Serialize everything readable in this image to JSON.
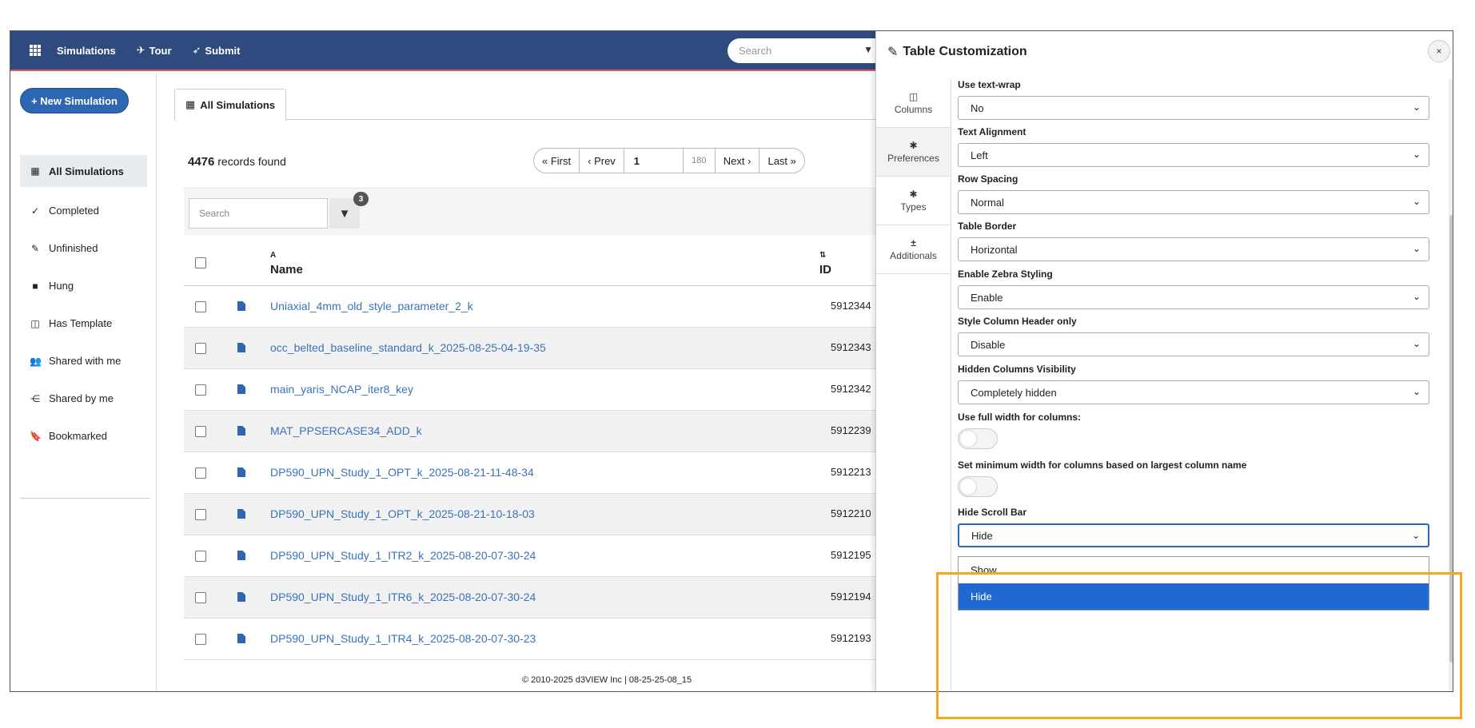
{
  "nav": {
    "items": [
      {
        "label": "Simulations",
        "icon": "grid-icon"
      },
      {
        "label": "Tour",
        "icon": "plane-icon"
      },
      {
        "label": "Submit",
        "icon": "rocket-icon"
      }
    ],
    "search_placeholder": "Search"
  },
  "sidebar": {
    "new_button": "+ New Simulation",
    "items": [
      {
        "label": "All Simulations",
        "icon": "table-icon",
        "active": true
      },
      {
        "label": "Completed",
        "icon": "check-icon"
      },
      {
        "label": "Unfinished",
        "icon": "edit-icon"
      },
      {
        "label": "Hung",
        "icon": "stop-icon"
      },
      {
        "label": "Has Template",
        "icon": "template-icon"
      },
      {
        "label": "Shared with me",
        "icon": "users-icon"
      },
      {
        "label": "Shared by me",
        "icon": "share-icon"
      },
      {
        "label": "Bookmarked",
        "icon": "bookmark-icon"
      }
    ]
  },
  "main": {
    "tab_label": "All Simulations",
    "records_count": "4476",
    "records_suffix": "records found",
    "pager": {
      "first": "« First",
      "prev": "‹ Prev",
      "page": "1",
      "total": "180",
      "next": "Next ›",
      "last": "Last »"
    },
    "search_placeholder": "Search",
    "filter_count": "3",
    "columns": {
      "name_sort": "A",
      "name": "Name",
      "id_sort": "⇅",
      "id": "ID"
    },
    "rows": [
      {
        "name": "Uniaxial_4mm_old_style_parameter_2_k",
        "id": "5912344"
      },
      {
        "name": "occ_belted_baseline_standard_k_2025-08-25-04-19-35",
        "id": "5912343"
      },
      {
        "name": "main_yaris_NCAP_iter8_key",
        "id": "5912342"
      },
      {
        "name": "MAT_PPSERCASE34_ADD_k",
        "id": "5912239"
      },
      {
        "name": "DP590_UPN_Study_1_OPT_k_2025-08-21-11-48-34",
        "id": "5912213"
      },
      {
        "name": "DP590_UPN_Study_1_OPT_k_2025-08-21-10-18-03",
        "id": "5912210"
      },
      {
        "name": "DP590_UPN_Study_1_ITR2_k_2025-08-20-07-30-24",
        "id": "5912195"
      },
      {
        "name": "DP590_UPN_Study_1_ITR6_k_2025-08-20-07-30-24",
        "id": "5912194"
      },
      {
        "name": "DP590_UPN_Study_1_ITR4_k_2025-08-20-07-30-23",
        "id": "5912193"
      }
    ],
    "footer": "© 2010-2025 d3VIEW Inc | 08-25-25-08_15"
  },
  "panel": {
    "title": "Table Customization",
    "close": "×",
    "tabs": [
      {
        "label": "Columns",
        "icon": "columns-icon"
      },
      {
        "label": "Preferences",
        "icon": "gear-icon",
        "active": true
      },
      {
        "label": "Types",
        "icon": "gear-icon"
      },
      {
        "label": "Additionals",
        "icon": "plus-minus-icon"
      }
    ],
    "fields": {
      "text_wrap": {
        "label": "Use text-wrap",
        "value": "No"
      },
      "text_alignment": {
        "label": "Text Alignment",
        "value": "Left"
      },
      "row_spacing": {
        "label": "Row Spacing",
        "value": "Normal"
      },
      "table_border": {
        "label": "Table Border",
        "value": "Horizontal"
      },
      "zebra": {
        "label": "Enable Zebra Styling",
        "value": "Enable"
      },
      "style_header": {
        "label": "Style Column Header only",
        "value": "Disable"
      },
      "hidden_cols": {
        "label": "Hidden Columns Visibility",
        "value": "Completely hidden"
      },
      "full_width": {
        "label": "Use full width for columns:"
      },
      "min_width": {
        "label": "Set minimum width for columns based on largest column name"
      },
      "hide_scroll": {
        "label": "Hide Scroll Bar",
        "value": "Hide",
        "options": [
          "Show",
          "Hide"
        ]
      }
    }
  },
  "colors": {
    "nav_bg": "#2f4a7e",
    "accent": "#2e67b1",
    "highlight": "#f5a623",
    "selected_option": "#1f69d0"
  }
}
